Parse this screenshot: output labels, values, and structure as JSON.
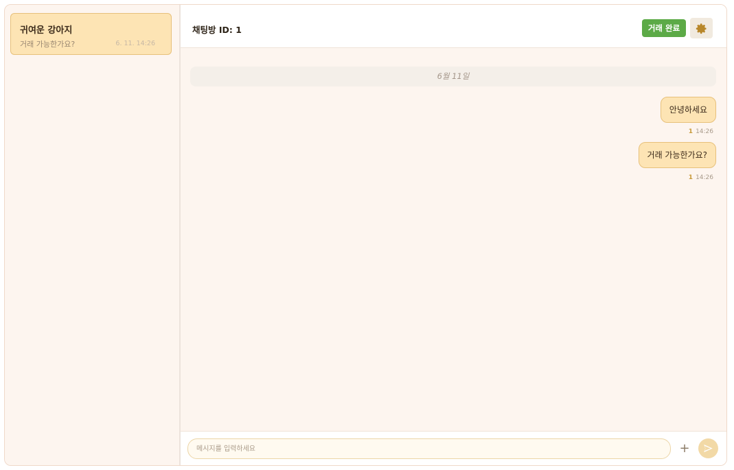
{
  "sidebar": {
    "items": [
      {
        "title": "귀여운 강아지",
        "preview": "거래 가능한가요?",
        "time": "6. 11. 14:26"
      }
    ]
  },
  "header": {
    "title": "채팅방 ID: 1",
    "complete_label": "거래 완료",
    "settings_icon": "gear-icon"
  },
  "messages": {
    "date_separator": "6월 11일",
    "items": [
      {
        "text": "안녕하세요",
        "read": "1",
        "time": "14:26"
      },
      {
        "text": "거래 가능한가요?",
        "read": "1",
        "time": "14:26"
      }
    ]
  },
  "composer": {
    "placeholder": "메시지를 입력하세요",
    "plus_label": "+",
    "send_icon": "send-icon"
  },
  "colors": {
    "accent_bubble": "#fde4b4",
    "complete_button": "#5caa47",
    "background": "#fdf5ef"
  }
}
